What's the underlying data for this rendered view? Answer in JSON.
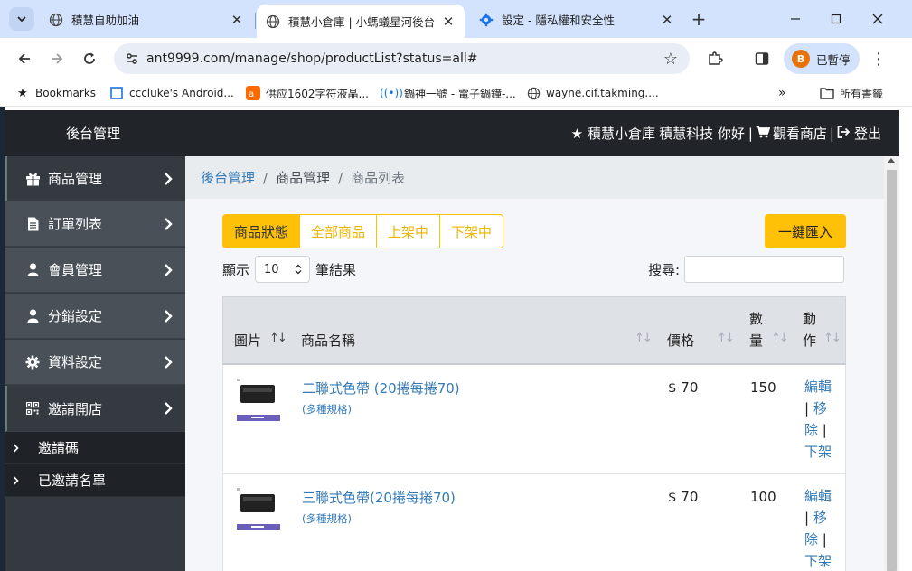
{
  "browser": {
    "tabs": [
      {
        "title": "積慧自助加油",
        "active": false
      },
      {
        "title": "積慧小倉庫 | 小螞蟻星河後台管",
        "active": true
      },
      {
        "title": "設定 - 隱私權和安全性",
        "active": false
      }
    ],
    "url": "ant9999.com/manage/shop/productList?status=all#",
    "profile": {
      "initial": "B",
      "label": "已暫停"
    },
    "bookmarks": [
      {
        "label": "Bookmarks"
      },
      {
        "label": "cccluke's Android..."
      },
      {
        "label": "供应1602字符液晶..."
      },
      {
        "label": "鍋神一號 - 電子鍋鐘-..."
      },
      {
        "label": "wayne.cif.takming...."
      }
    ],
    "all_bookmarks": "所有書籤"
  },
  "site": {
    "brand": "後台管理",
    "shop_name": "積慧小倉庫",
    "greeting": "積慧科技 你好",
    "sep1": "|",
    "view_shop": "觀看商店",
    "sep2": "|",
    "logout": "登出"
  },
  "sidebar": {
    "items": [
      {
        "label": "商品管理",
        "icon": "gift-icon"
      },
      {
        "label": "訂單列表",
        "icon": "file-icon"
      },
      {
        "label": "會員管理",
        "icon": "user-icon"
      },
      {
        "label": "分銷設定",
        "icon": "user-icon"
      },
      {
        "label": "資料設定",
        "icon": "gear-icon"
      },
      {
        "label": "邀請開店",
        "icon": "qrcode-icon"
      }
    ],
    "subitems": [
      {
        "label": "邀請碼"
      },
      {
        "label": "已邀請名單"
      }
    ]
  },
  "breadcrumb": {
    "root": "後台管理",
    "middle": "商品管理",
    "current": "商品列表",
    "sep": "/"
  },
  "filters": {
    "status_label": "商品狀態",
    "all": "全部商品",
    "on": "上架中",
    "off": "下架中"
  },
  "import_button": "一鍵匯入",
  "pager": {
    "show": "顯示",
    "per_page": "10",
    "suffix": "筆結果"
  },
  "search": {
    "label": "搜尋:",
    "value": ""
  },
  "table": {
    "headers": {
      "image": "圖片",
      "name": "商品名稱",
      "price": "價格",
      "qty_line1": "數",
      "qty_line2": "量",
      "action_line1": "動",
      "action_line2": "作"
    },
    "rows": [
      {
        "name": "二聯式色帶 (20捲每捲70)",
        "spec": "(多種規格)",
        "price": "$ 70",
        "qty": "150"
      },
      {
        "name": "三聯式色帶(20捲每捲70)",
        "spec": "(多種規格)",
        "price": "$ 70",
        "qty": "100"
      }
    ],
    "actions": {
      "edit": "編輯",
      "remove_1": "移",
      "remove_2": "除",
      "unlist": "下架",
      "pipe": "|"
    }
  }
}
